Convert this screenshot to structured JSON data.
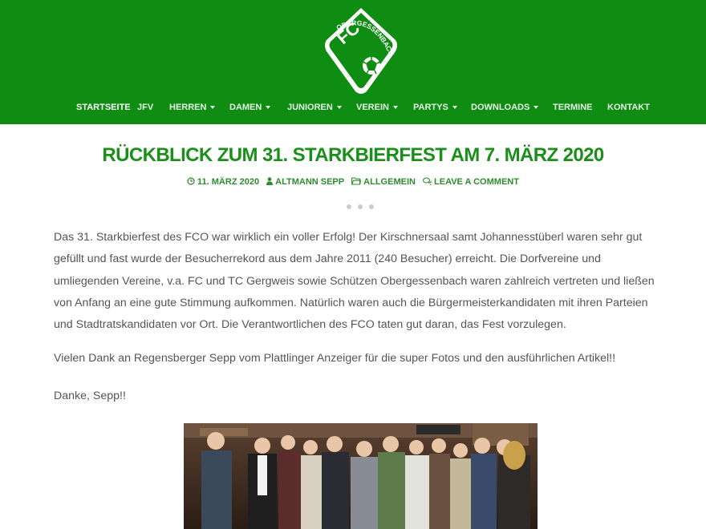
{
  "brand": {
    "logo_text_top": "FC",
    "logo_text_arc": "OBERGESSENBACH",
    "primary_color": "#0f8c12",
    "title_color": "#1a8f1a"
  },
  "nav": {
    "items": [
      {
        "label": "STARTSEITE",
        "has_dropdown": false,
        "active": true
      },
      {
        "label": "JFV",
        "has_dropdown": false
      },
      {
        "label": "HERREN",
        "has_dropdown": true
      },
      {
        "label": "DAMEN",
        "has_dropdown": true
      },
      {
        "label": "JUNIOREN",
        "has_dropdown": true
      },
      {
        "label": "VEREIN",
        "has_dropdown": true
      },
      {
        "label": "PARTYS",
        "has_dropdown": true
      },
      {
        "label": "DOWNLOADS",
        "has_dropdown": true
      },
      {
        "label": "TERMINE",
        "has_dropdown": false
      },
      {
        "label": "KONTAKT",
        "has_dropdown": false
      }
    ]
  },
  "post": {
    "title": "RÜCKBLICK ZUM 31. STARKBIERFEST AM 7. MÄRZ 2020",
    "meta": {
      "date": "11. MÄRZ 2020",
      "date_icon": "clock-icon",
      "author": "ALTMANN SEPP",
      "author_icon": "user-icon",
      "category": "ALLGEMEIN",
      "category_icon": "folder-icon",
      "comments": "LEAVE A COMMENT",
      "comments_icon": "comments-icon"
    },
    "paragraphs": [
      "Das 31. Starkbierfest des FCO war wirklich ein voller Erfolg! Der Kirschnersaal samt Johannesstüberl waren sehr gut gefüllt und fast wurde der Besucherrekord aus dem Jahre 2011 (240 Besucher) erreicht. Die Dorfvereine und umliegenden Vereine, v.a. FC und TC Gergweis sowie Schützen Obergessenbach waren zahlreich vertreten und ließen von Anfang an eine gute Stimmung aufkommen. Natürlich waren auch die Bürgermeisterkandidaten mit ihren Parteien und Stadtratskandidaten vor Ort. Die Verantwortlichen des FCO taten gut daran, das Fest vorzulegen.",
      "Vielen Dank an Regensberger Sepp vom Plattlinger Anzeiger für die super Fotos und den ausführlichen Artikel!!",
      "Danke, Sepp!!"
    ]
  }
}
